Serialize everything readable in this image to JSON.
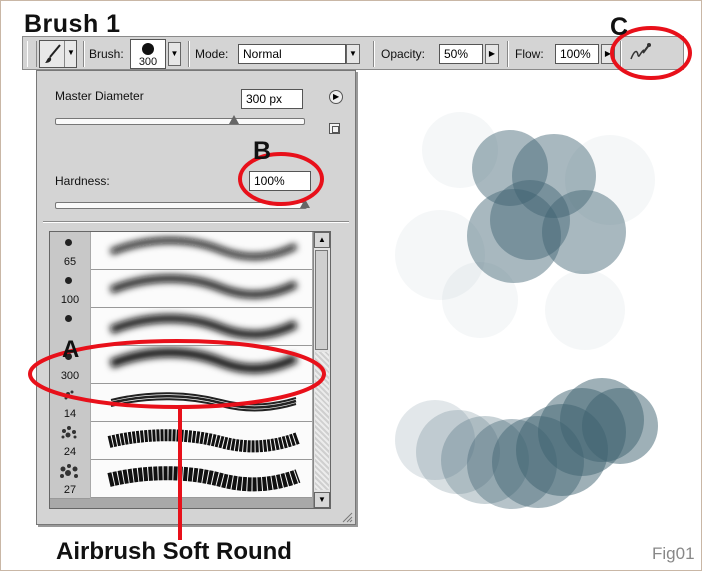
{
  "title": "Brush 1",
  "toolbar": {
    "brush_label": "Brush:",
    "brush_size": "300",
    "mode_label": "Mode:",
    "mode_value": "Normal",
    "opacity_label": "Opacity:",
    "opacity_value": "50%",
    "flow_label": "Flow:",
    "flow_value": "100%"
  },
  "panel": {
    "master_diameter_label": "Master Diameter",
    "master_diameter_value": "300 px",
    "master_diameter_fraction": 0.72,
    "hardness_label": "Hardness:",
    "hardness_value": "100%",
    "hardness_fraction": 1.0,
    "presets": [
      {
        "size": "65"
      },
      {
        "size": "100"
      },
      {
        "size": ""
      },
      {
        "size": "300"
      },
      {
        "size": "14"
      },
      {
        "size": "24"
      },
      {
        "size": "27"
      }
    ]
  },
  "annotations": {
    "a": "A",
    "b": "B",
    "c": "C",
    "caption": "Airbrush Soft Round",
    "figure": "Fig01"
  },
  "colors": {
    "annotation_red": "#e8101a",
    "dab_color": "#3e6170",
    "toolbar_bg": "#d4d4d4"
  },
  "icons": {
    "tool": "brush-tool-icon",
    "airbrush": "airbrush-toggle-icon",
    "panel_menu": "panel-menu-arrow-icon",
    "new_preset": "new-preset-icon"
  }
}
